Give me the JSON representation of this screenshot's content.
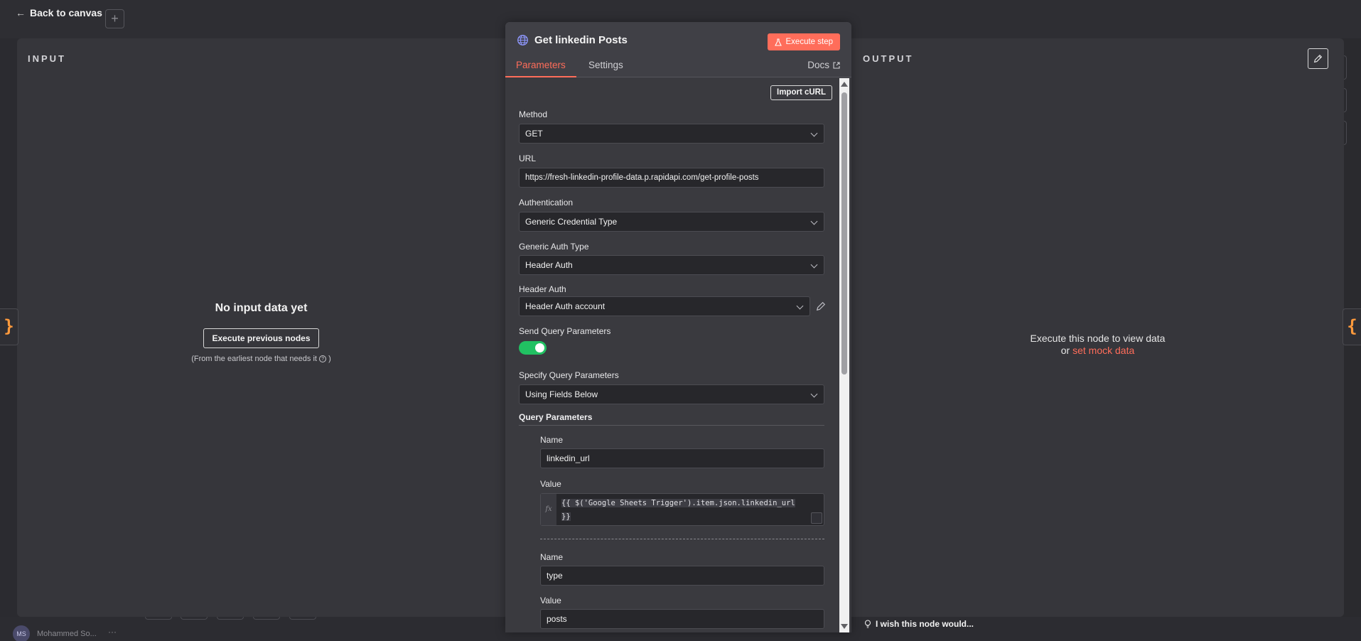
{
  "nav": {
    "back_label": "Back to canvas",
    "plus": "+"
  },
  "background": {
    "user_initials": "MS",
    "user_name": "Mohammed So...",
    "more": "···"
  },
  "input_panel": {
    "title": "INPUT",
    "empty_title": "No input data yet",
    "execute_button": "Execute previous nodes",
    "hint_prefix": "(From the earliest node that needs it",
    "hint_suffix": ")"
  },
  "output_panel": {
    "title": "OUTPUT",
    "message": "Execute this node to view data",
    "or_text": "or",
    "mock_link": "set mock data"
  },
  "node": {
    "title": "Get linkedin Posts",
    "icon": "globe-icon",
    "execute_button": "Execute step",
    "tabs": [
      "Parameters",
      "Settings"
    ],
    "active_tab": "Parameters",
    "docs_label": "Docs",
    "import_curl": "Import cURL"
  },
  "params": {
    "method": {
      "label": "Method",
      "value": "GET"
    },
    "url": {
      "label": "URL",
      "value": "https://fresh-linkedin-profile-data.p.rapidapi.com/get-profile-posts"
    },
    "authentication": {
      "label": "Authentication",
      "value": "Generic Credential Type"
    },
    "generic_auth_type": {
      "label": "Generic Auth Type",
      "value": "Header Auth"
    },
    "header_auth": {
      "label": "Header Auth",
      "value": "Header Auth account"
    },
    "send_query": {
      "label": "Send Query Parameters",
      "enabled": true
    },
    "specify_query": {
      "label": "Specify Query Parameters",
      "value": "Using Fields Below"
    },
    "query_parameters": {
      "title": "Query Parameters",
      "items": [
        {
          "name_label": "Name",
          "name": "linkedin_url",
          "value_label": "Value",
          "value_line1": "{{ $('Google Sheets Trigger').item.json.linkedin_url",
          "value_line2": "}}",
          "fx": "fx"
        },
        {
          "name_label": "Name",
          "name": "type",
          "value_label": "Value",
          "value": "posts"
        }
      ]
    }
  },
  "feedback": {
    "label": "I wish this node would..."
  },
  "colors": {
    "accent": "#ff6d5a",
    "toggle_on": "#21c162",
    "brace": "#ff9a3c"
  }
}
